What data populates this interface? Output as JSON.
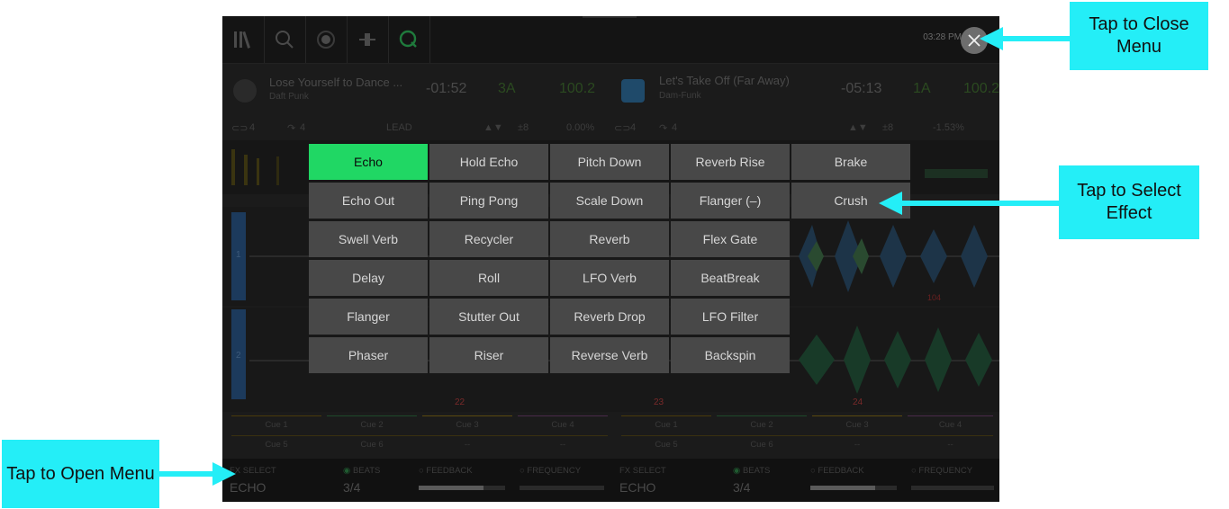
{
  "topbar": {
    "clock": "03:28 PM",
    "icons": [
      "library-icon",
      "search-icon",
      "record-icon",
      "crossfader-icon",
      "quantize-icon"
    ]
  },
  "deck_left": {
    "title": "Lose Yourself to Dance ...",
    "artist": "Daft Punk",
    "time": "-01:52",
    "key": "3A",
    "bpm": "100.2",
    "loop": "4",
    "jump": "4",
    "lead": "LEAD",
    "range": "±8",
    "pitch": "0.00%",
    "beat_markers": [
      "22"
    ]
  },
  "deck_right": {
    "title": "Let's Take Off (Far Away)",
    "artist": "Dam-Funk",
    "time": "-05:13",
    "key": "1A",
    "bpm": "100.2",
    "loop": "4",
    "jump": "4",
    "range": "±8",
    "pitch": "-1.53%",
    "beat_markers": [
      "23",
      "24"
    ],
    "marker_104": "104"
  },
  "lane_labels": [
    "1",
    "2"
  ],
  "cues_left": {
    "row1": [
      "Cue 1",
      "Cue 2",
      "Cue 3",
      "Cue 4"
    ],
    "row2": [
      "Cue 5",
      "Cue 6",
      "--",
      "--"
    ]
  },
  "cues_right": {
    "row1": [
      "Cue 1",
      "Cue 2",
      "Cue 3",
      "Cue 4"
    ],
    "row2": [
      "Cue 5",
      "Cue 6",
      "--",
      "--"
    ]
  },
  "fx_left": {
    "select_label": "FX SELECT",
    "effect": "ECHO",
    "beats_label": "BEATS",
    "beats": "3/4",
    "feedback_label": "FEEDBACK",
    "frequency_label": "FREQUENCY",
    "feedback_level": 0.75
  },
  "fx_right": {
    "select_label": "FX SELECT",
    "effect": "ECHO",
    "beats_label": "BEATS",
    "beats": "3/4",
    "feedback_label": "FEEDBACK",
    "frequency_label": "FREQUENCY",
    "feedback_level": 0.75
  },
  "fx_menu": {
    "selected": "Echo",
    "effects": [
      [
        "Echo",
        "Hold Echo",
        "Pitch Down",
        "Reverb Rise",
        "Brake"
      ],
      [
        "Echo Out",
        "Ping Pong",
        "Scale Down",
        "Flanger (–)",
        "Crush"
      ],
      [
        "Swell Verb",
        "Recycler",
        "Reverb",
        "Flex Gate"
      ],
      [
        "Delay",
        "Roll",
        "LFO Verb",
        "BeatBreak"
      ],
      [
        "Flanger",
        "Stutter Out",
        "Reverb Drop",
        "LFO Filter"
      ],
      [
        "Phaser",
        "Riser",
        "Reverse Verb",
        "Backspin"
      ]
    ]
  },
  "callouts": {
    "close": "Tap to Close Menu",
    "select": "Tap to Select Effect",
    "open": "Tap to Open Menu"
  },
  "colors": {
    "selected": "#20d764",
    "callout": "#24eef7",
    "accent_green": "#20d764"
  }
}
